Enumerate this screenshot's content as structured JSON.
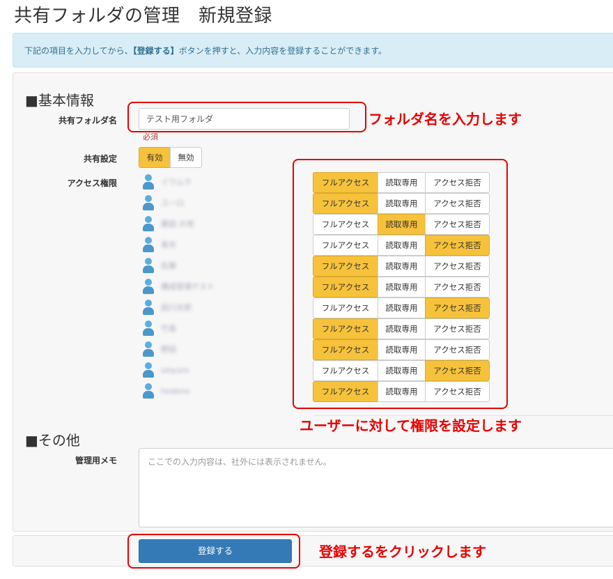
{
  "page": {
    "title": "共有フォルダの管理　新規登録"
  },
  "info": {
    "prefix": "下記の項目を入力してから、",
    "emphasis": "【登録する】",
    "suffix": "ボタンを押すと、入力内容を登録することができます。"
  },
  "basic": {
    "heading": "■基本情報",
    "folder_name_label": "共有フォルダ名",
    "folder_name_value": "テスト用フォルダ",
    "required_note": "必須",
    "share_label": "共有設定",
    "share_options": [
      "有効",
      "無効"
    ],
    "share_selected": "有効",
    "access_label": "アクセス権限",
    "access_options": [
      "フルアクセス",
      "読取専用",
      "アクセス拒否"
    ],
    "users": [
      {
        "name": "イワムラ",
        "permission": "フルアクセス"
      },
      {
        "name": "ユーロ",
        "permission": "フルアクセス"
      },
      {
        "name": "藤田 大地",
        "permission": "読取専用"
      },
      {
        "name": "青木",
        "permission": "アクセス拒否"
      },
      {
        "name": "佐藤",
        "permission": "フルアクセス"
      },
      {
        "name": "構成管理テスト",
        "permission": "フルアクセス"
      },
      {
        "name": "田川太郎",
        "permission": "アクセス拒否"
      },
      {
        "name": "竹島",
        "permission": "フルアクセス"
      },
      {
        "name": "野田",
        "permission": "フルアクセス"
      },
      {
        "name": "seiyuro",
        "permission": "アクセス拒否"
      },
      {
        "name": "hodeno",
        "permission": "フルアクセス"
      }
    ]
  },
  "other": {
    "heading": "■その他",
    "memo_label": "管理用メモ",
    "memo_placeholder": "ここでの入力内容は、社外には表示されません。"
  },
  "submit_label": "登録する",
  "annotations": {
    "folder": "フォルダ名を入力します",
    "access": "ユーザーに対して権限を設定します",
    "submit": "登録するをクリックします"
  },
  "colors": {
    "active": "#f7c23b",
    "primary": "#337ab7",
    "annotation": "#e60000",
    "info_bg": "#d9edf7"
  }
}
